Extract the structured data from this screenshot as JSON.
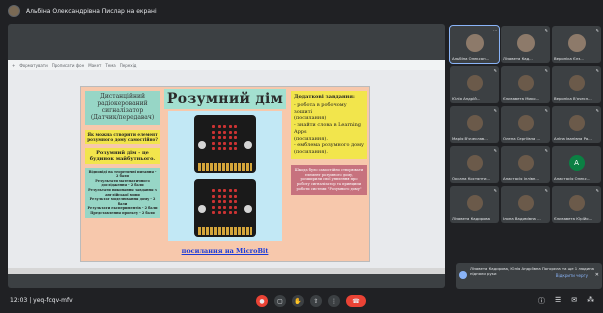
{
  "presenter_banner": "Альбіна Олександрівна Пислар на екрані",
  "slides_toolbar": {
    "items": [
      "Форматувати",
      "Прописати фон",
      "Макет",
      "Тема",
      "Перехід"
    ],
    "zoom": "+"
  },
  "slide": {
    "left": {
      "title": "Дистанційний радіокерований сигналізатор (Датчик/передавач)",
      "question": "Як можна створити елемент розумного дому самостійно?",
      "answer": "Розумний дім - це будинок майбутнього.",
      "scores": [
        "Відповіді на теоретичні питання - 2 бали",
        "Результати математичного дослідження - 2 бали",
        "Результати виконання завдання з англійської мови",
        "Результат моделювання дому - 2 бали",
        "Результати експериментів - 2 бали",
        "Представлення проекту - 2 бали"
      ]
    },
    "middle": {
      "title": "Розумний дім",
      "link": "посилання на MicroBit"
    },
    "right": {
      "tasks_title": "Додаткові завдання:",
      "tasks": [
        "- робота в робочому зошиті",
        "(посилання)",
        "- знайти слова в Learning Apps",
        "(посилання).",
        "- емблема розумного дому",
        "(посилання)."
      ],
      "note": "Шкода було самостійно створювати елемент розумного дому, розширили свої уявлення про роботу сигналізатор та принципи роботи системи \"Розумного дому\""
    }
  },
  "participants": [
    {
      "name": "Альбіна Олексан...",
      "active": true
    },
    {
      "name": "Лізавета Кад...",
      "active": false
    },
    {
      "name": "Вероніка Єлз...",
      "active": false
    },
    {
      "name": "Юлія Андрій...",
      "active": false
    },
    {
      "name": "Єлизавета Мико...",
      "active": false
    },
    {
      "name": "Вероніка В'ячесл...",
      "active": false
    },
    {
      "name": "Марія В'ячеслав...",
      "active": false
    },
    {
      "name": "Олена Сергіївна ...",
      "active": false
    },
    {
      "name": "Аліна Іванівна Ра...",
      "active": false
    },
    {
      "name": "Оксана Костянти...",
      "active": false
    },
    {
      "name": "Анастасія Іллівн...",
      "active": false
    },
    {
      "name": "Анастасія Олекс...",
      "active": false,
      "letter": "А"
    },
    {
      "name": "Лізавета Кадирова",
      "active": false
    },
    {
      "name": "Ілона Вадимівна ...",
      "active": false
    },
    {
      "name": "Єлизавета Юрійо...",
      "active": false
    }
  ],
  "toast": {
    "text": "Лізавета Кадирова, Юлія Андріївна Погорєла та ще 1 людина підняли руки",
    "action": "Відкрити чергу"
  },
  "bottom": {
    "time": "12:03",
    "meeting_code": "yeq-fcqv-mfv",
    "separator": "|"
  }
}
